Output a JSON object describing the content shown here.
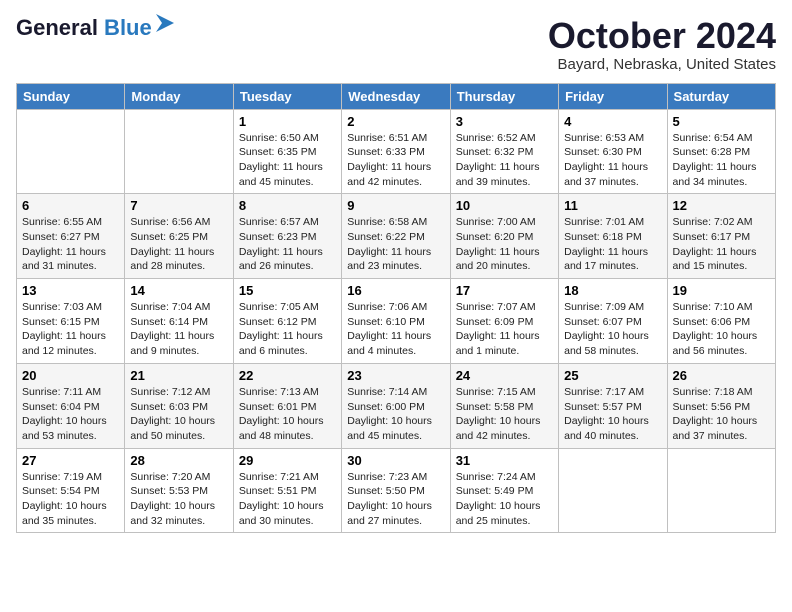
{
  "logo": {
    "line1": "General",
    "line2": "Blue"
  },
  "title": "October 2024",
  "location": "Bayard, Nebraska, United States",
  "days_of_week": [
    "Sunday",
    "Monday",
    "Tuesday",
    "Wednesday",
    "Thursday",
    "Friday",
    "Saturday"
  ],
  "weeks": [
    [
      {
        "day": "",
        "info": ""
      },
      {
        "day": "",
        "info": ""
      },
      {
        "day": "1",
        "info": "Sunrise: 6:50 AM\nSunset: 6:35 PM\nDaylight: 11 hours and 45 minutes."
      },
      {
        "day": "2",
        "info": "Sunrise: 6:51 AM\nSunset: 6:33 PM\nDaylight: 11 hours and 42 minutes."
      },
      {
        "day": "3",
        "info": "Sunrise: 6:52 AM\nSunset: 6:32 PM\nDaylight: 11 hours and 39 minutes."
      },
      {
        "day": "4",
        "info": "Sunrise: 6:53 AM\nSunset: 6:30 PM\nDaylight: 11 hours and 37 minutes."
      },
      {
        "day": "5",
        "info": "Sunrise: 6:54 AM\nSunset: 6:28 PM\nDaylight: 11 hours and 34 minutes."
      }
    ],
    [
      {
        "day": "6",
        "info": "Sunrise: 6:55 AM\nSunset: 6:27 PM\nDaylight: 11 hours and 31 minutes."
      },
      {
        "day": "7",
        "info": "Sunrise: 6:56 AM\nSunset: 6:25 PM\nDaylight: 11 hours and 28 minutes."
      },
      {
        "day": "8",
        "info": "Sunrise: 6:57 AM\nSunset: 6:23 PM\nDaylight: 11 hours and 26 minutes."
      },
      {
        "day": "9",
        "info": "Sunrise: 6:58 AM\nSunset: 6:22 PM\nDaylight: 11 hours and 23 minutes."
      },
      {
        "day": "10",
        "info": "Sunrise: 7:00 AM\nSunset: 6:20 PM\nDaylight: 11 hours and 20 minutes."
      },
      {
        "day": "11",
        "info": "Sunrise: 7:01 AM\nSunset: 6:18 PM\nDaylight: 11 hours and 17 minutes."
      },
      {
        "day": "12",
        "info": "Sunrise: 7:02 AM\nSunset: 6:17 PM\nDaylight: 11 hours and 15 minutes."
      }
    ],
    [
      {
        "day": "13",
        "info": "Sunrise: 7:03 AM\nSunset: 6:15 PM\nDaylight: 11 hours and 12 minutes."
      },
      {
        "day": "14",
        "info": "Sunrise: 7:04 AM\nSunset: 6:14 PM\nDaylight: 11 hours and 9 minutes."
      },
      {
        "day": "15",
        "info": "Sunrise: 7:05 AM\nSunset: 6:12 PM\nDaylight: 11 hours and 6 minutes."
      },
      {
        "day": "16",
        "info": "Sunrise: 7:06 AM\nSunset: 6:10 PM\nDaylight: 11 hours and 4 minutes."
      },
      {
        "day": "17",
        "info": "Sunrise: 7:07 AM\nSunset: 6:09 PM\nDaylight: 11 hours and 1 minute."
      },
      {
        "day": "18",
        "info": "Sunrise: 7:09 AM\nSunset: 6:07 PM\nDaylight: 10 hours and 58 minutes."
      },
      {
        "day": "19",
        "info": "Sunrise: 7:10 AM\nSunset: 6:06 PM\nDaylight: 10 hours and 56 minutes."
      }
    ],
    [
      {
        "day": "20",
        "info": "Sunrise: 7:11 AM\nSunset: 6:04 PM\nDaylight: 10 hours and 53 minutes."
      },
      {
        "day": "21",
        "info": "Sunrise: 7:12 AM\nSunset: 6:03 PM\nDaylight: 10 hours and 50 minutes."
      },
      {
        "day": "22",
        "info": "Sunrise: 7:13 AM\nSunset: 6:01 PM\nDaylight: 10 hours and 48 minutes."
      },
      {
        "day": "23",
        "info": "Sunrise: 7:14 AM\nSunset: 6:00 PM\nDaylight: 10 hours and 45 minutes."
      },
      {
        "day": "24",
        "info": "Sunrise: 7:15 AM\nSunset: 5:58 PM\nDaylight: 10 hours and 42 minutes."
      },
      {
        "day": "25",
        "info": "Sunrise: 7:17 AM\nSunset: 5:57 PM\nDaylight: 10 hours and 40 minutes."
      },
      {
        "day": "26",
        "info": "Sunrise: 7:18 AM\nSunset: 5:56 PM\nDaylight: 10 hours and 37 minutes."
      }
    ],
    [
      {
        "day": "27",
        "info": "Sunrise: 7:19 AM\nSunset: 5:54 PM\nDaylight: 10 hours and 35 minutes."
      },
      {
        "day": "28",
        "info": "Sunrise: 7:20 AM\nSunset: 5:53 PM\nDaylight: 10 hours and 32 minutes."
      },
      {
        "day": "29",
        "info": "Sunrise: 7:21 AM\nSunset: 5:51 PM\nDaylight: 10 hours and 30 minutes."
      },
      {
        "day": "30",
        "info": "Sunrise: 7:23 AM\nSunset: 5:50 PM\nDaylight: 10 hours and 27 minutes."
      },
      {
        "day": "31",
        "info": "Sunrise: 7:24 AM\nSunset: 5:49 PM\nDaylight: 10 hours and 25 minutes."
      },
      {
        "day": "",
        "info": ""
      },
      {
        "day": "",
        "info": ""
      }
    ]
  ]
}
